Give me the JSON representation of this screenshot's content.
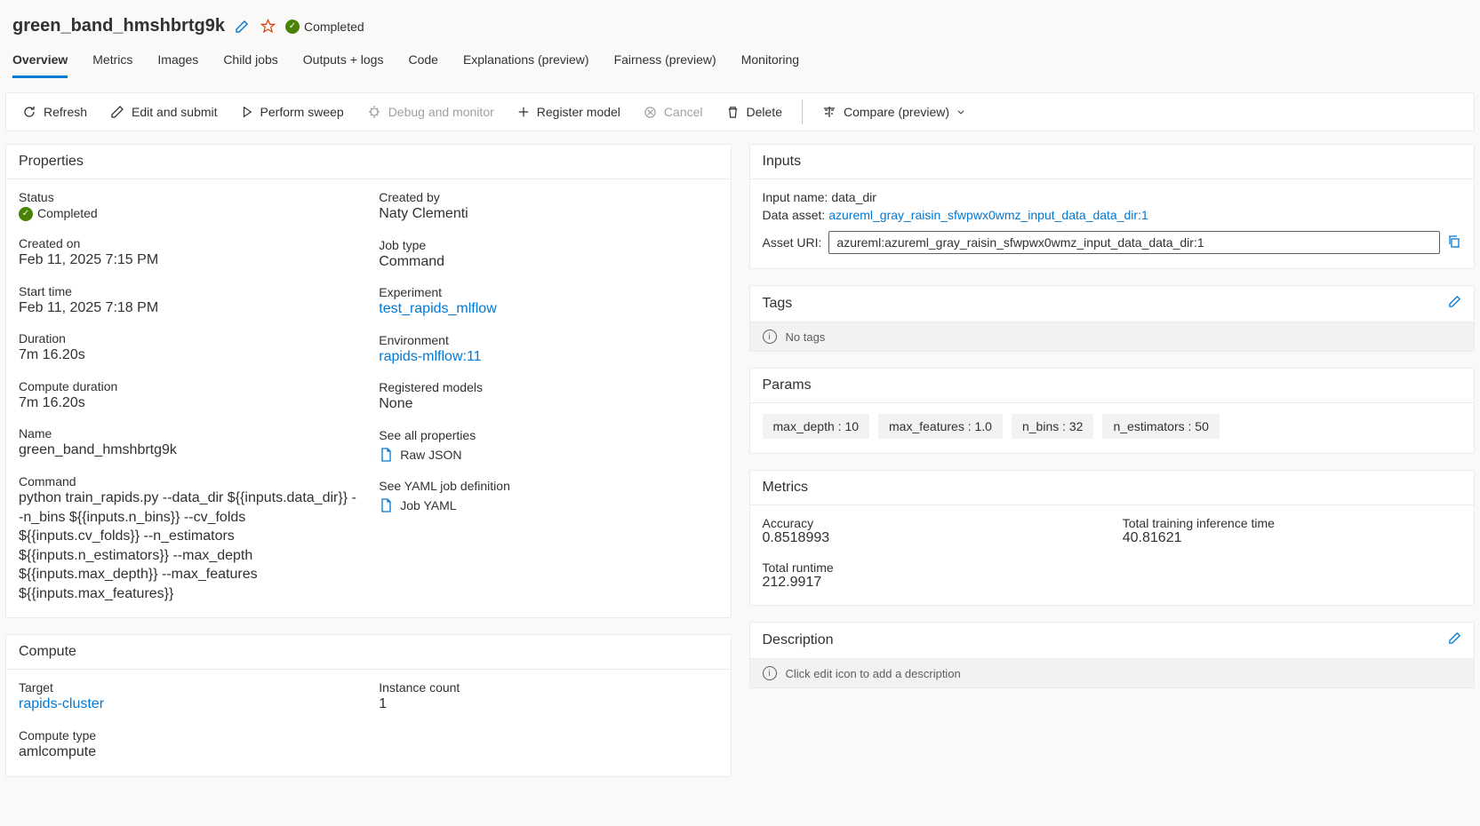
{
  "header": {
    "title": "green_band_hmshbrtg9k",
    "status": "Completed"
  },
  "tabs": [
    "Overview",
    "Metrics",
    "Images",
    "Child jobs",
    "Outputs + logs",
    "Code",
    "Explanations (preview)",
    "Fairness (preview)",
    "Monitoring"
  ],
  "toolbar": {
    "refresh": "Refresh",
    "edit_submit": "Edit and submit",
    "perform_sweep": "Perform sweep",
    "debug_monitor": "Debug and monitor",
    "register_model": "Register model",
    "cancel": "Cancel",
    "delete": "Delete",
    "compare": "Compare (preview)"
  },
  "properties": {
    "title": "Properties",
    "left": {
      "status_label": "Status",
      "status_value": "Completed",
      "created_on_label": "Created on",
      "created_on_value": "Feb 11, 2025 7:15 PM",
      "start_time_label": "Start time",
      "start_time_value": "Feb 11, 2025 7:18 PM",
      "duration_label": "Duration",
      "duration_value": "7m 16.20s",
      "compute_duration_label": "Compute duration",
      "compute_duration_value": "7m 16.20s",
      "name_label": "Name",
      "name_value": "green_band_hmshbrtg9k",
      "command_label": "Command",
      "command_value": "python train_rapids.py --data_dir ${{inputs.data_dir}} --n_bins ${{inputs.n_bins}} --cv_folds ${{inputs.cv_folds}} --n_estimators ${{inputs.n_estimators}} --max_depth ${{inputs.max_depth}} --max_features ${{inputs.max_features}}"
    },
    "right": {
      "created_by_label": "Created by",
      "created_by_value": "Naty Clementi",
      "job_type_label": "Job type",
      "job_type_value": "Command",
      "experiment_label": "Experiment",
      "experiment_value": "test_rapids_mlflow",
      "environment_label": "Environment",
      "environment_value": "rapids-mlflow:11",
      "registered_models_label": "Registered models",
      "registered_models_value": "None",
      "see_all_label": "See all properties",
      "raw_json": "Raw JSON",
      "see_yaml_label": "See YAML job definition",
      "job_yaml": "Job YAML"
    }
  },
  "compute": {
    "title": "Compute",
    "target_label": "Target",
    "target_value": "rapids-cluster",
    "instance_count_label": "Instance count",
    "instance_count_value": "1",
    "compute_type_label": "Compute type",
    "compute_type_value": "amlcompute"
  },
  "inputs": {
    "title": "Inputs",
    "input_name_label": "Input name: data_dir",
    "data_asset_label": "Data asset: ",
    "data_asset_value": "azureml_gray_raisin_sfwpwx0wmz_input_data_data_dir:1",
    "asset_uri_label": "Asset URI:",
    "asset_uri_value": "azureml:azureml_gray_raisin_sfwpwx0wmz_input_data_data_dir:1"
  },
  "tags": {
    "title": "Tags",
    "empty": "No tags"
  },
  "params": {
    "title": "Params",
    "items": [
      "max_depth : 10",
      "max_features : 1.0",
      "n_bins : 32",
      "n_estimators : 50"
    ]
  },
  "metrics": {
    "title": "Metrics",
    "items": [
      {
        "label": "Accuracy",
        "value": "0.8518993"
      },
      {
        "label": "Total training inference time",
        "value": "40.81621"
      },
      {
        "label": "Total runtime",
        "value": "212.9917"
      }
    ]
  },
  "description": {
    "title": "Description",
    "placeholder": "Click edit icon to add a description"
  }
}
